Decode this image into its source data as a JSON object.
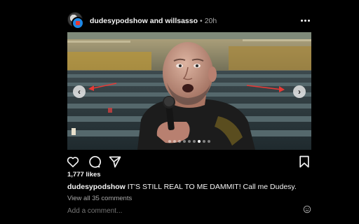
{
  "post": {
    "authors": "dudesypodshow and willsasso",
    "separator": "•",
    "time": "20h"
  },
  "media": {
    "prev_icon": "chevron-left-icon",
    "next_icon": "chevron-right-icon",
    "slide_count": 9,
    "active_slide": 7
  },
  "actions": {
    "like_icon": "heart-icon",
    "comment_icon": "comment-icon",
    "share_icon": "send-icon",
    "save_icon": "bookmark-icon"
  },
  "likes_text": "1,777 likes",
  "caption": {
    "username": "dudesypodshow",
    "text": "IT'S STILL REAL TO ME DAMMIT! Call me Dudesy."
  },
  "view_comments": "View all 35 comments",
  "comment_placeholder": "Add a comment...",
  "colors": {
    "background": "#000000",
    "text": "#f5f5f5",
    "muted": "#a8a8a8",
    "arrow_annotation": "#e53935"
  }
}
